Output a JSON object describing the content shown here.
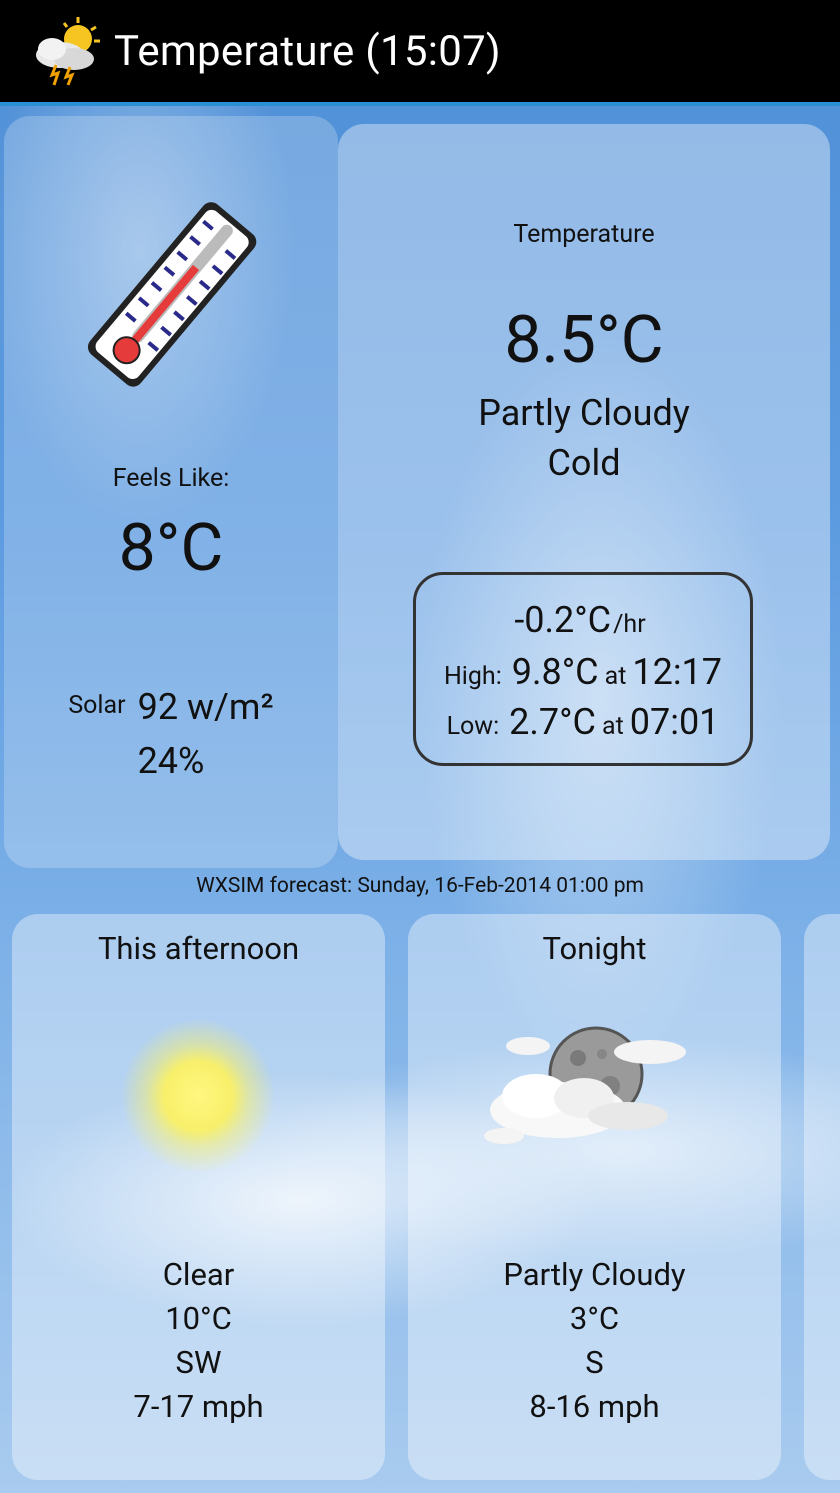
{
  "header": {
    "title": "Temperature (15:07)",
    "icon": "weather-app-icon"
  },
  "current": {
    "feels_like_label": "Feels Like:",
    "feels_like_value": "8°C",
    "solar_label": "Solar",
    "solar_value": "92 w/m²",
    "solar_percent": "24%",
    "panel_title": "Temperature",
    "temperature": "8.5°C",
    "condition": "Partly Cloudy",
    "feel": "Cold",
    "trend": "-0.2°C",
    "trend_unit": "/hr",
    "high_label": "High:",
    "high_value": "9.8°C",
    "high_at": "at",
    "high_time": "12:17",
    "low_label": "Low:",
    "low_value": "2.7°C",
    "low_at": "at",
    "low_time": "07:01"
  },
  "forecast": {
    "caption": "WXSIM forecast: Sunday, 16-Feb-2014 01:00 pm",
    "periods": [
      {
        "title": "This afternoon",
        "icon": "sun-icon",
        "condition": "Clear",
        "temp": "10°C",
        "wind_dir": "SW",
        "wind_speed": "7-17 mph"
      },
      {
        "title": "Tonight",
        "icon": "moon-cloud-icon",
        "condition": "Partly Cloudy",
        "temp": "3°C",
        "wind_dir": "S",
        "wind_speed": "8-16 mph"
      }
    ]
  }
}
